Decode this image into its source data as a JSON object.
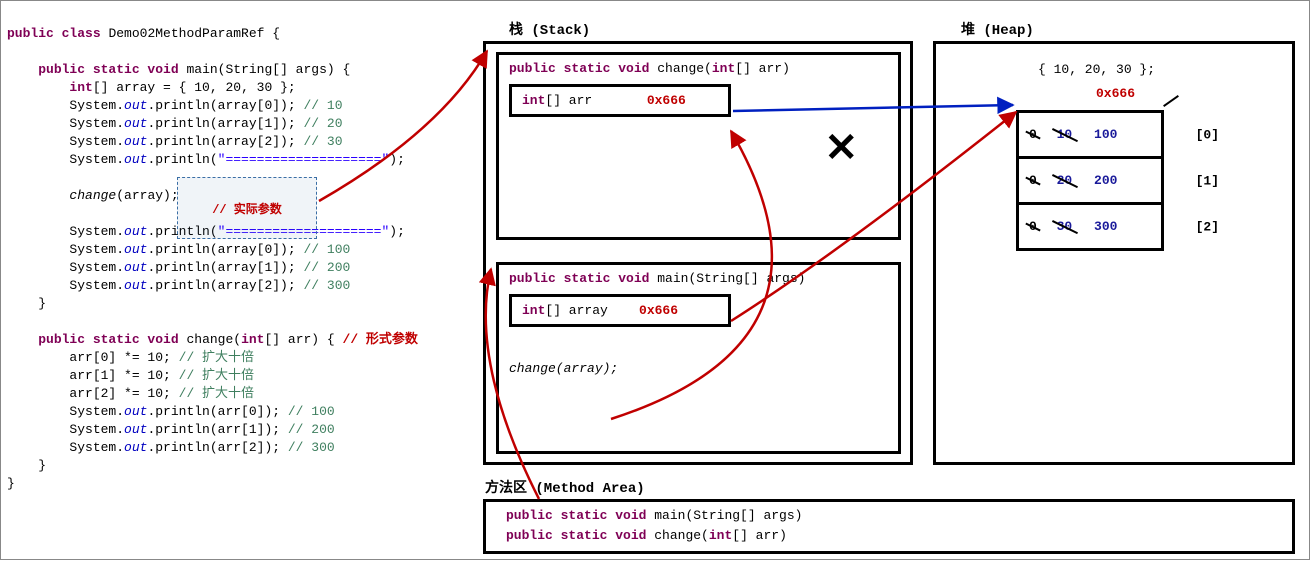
{
  "code": {
    "className": "Demo02MethodParamRef",
    "mainSig": "main(String[] args)",
    "arrayInit": "{ 10, 20, 30 };",
    "println0a": "System.",
    "out": "out",
    "println0b": ".println(array[0]);",
    "c10": "// 10",
    "println1b": ".println(array[1]);",
    "c20": "// 20",
    "println2b": ".println(array[2]);",
    "c30": "// 30",
    "sep": "\"====================\"",
    "changeCall": "change",
    "changeArg": "(array);",
    "actualParam": "// 实际参数",
    "after0b": ".println(array[0]);",
    "ca100": "// 100",
    "after1b": ".println(array[1]);",
    "ca200": "// 200",
    "after2b": ".println(array[2]);",
    "ca300": "// 300",
    "changeSig": "change(",
    "changeParam": "int",
    "changeParamRest": "[] arr) {",
    "formalParam": "// 形式参数",
    "body0": "arr[0] *= 10;",
    "expand": "// 扩大十倍",
    "body1": "arr[1] *= 10;",
    "body2": "arr[2] *= 10;",
    "carr0": ".println(arr[0]);",
    "cc100": "// 100",
    "carr1": ".println(arr[1]);",
    "cc200": "// 200",
    "carr2": ".println(arr[2]);",
    "cc300": "// 300"
  },
  "labels": {
    "stack": "栈 (Stack)",
    "heap": "堆 (Heap)",
    "methodArea": "方法区  (Method Area)"
  },
  "stack": {
    "changeSig": "public static void change(int[] arr)",
    "arrVar": "int[] arr",
    "arrAddr": "0x666",
    "mainSig": "public static void main(String[] args)",
    "arrayVar": "int[] array",
    "arrayAddr": "0x666",
    "call": "change(array);"
  },
  "heap": {
    "init": "{ 10, 20, 30 };",
    "addr": "0x666",
    "cells": [
      {
        "old0": "0",
        "old": "10",
        "new": "100",
        "idx": "[0]"
      },
      {
        "old0": "0",
        "old": "20",
        "new": "200",
        "idx": "[1]"
      },
      {
        "old0": "0",
        "old": "30",
        "new": "300",
        "idx": "[2]"
      }
    ]
  },
  "methodArea": {
    "mainSig": "public static void main(String[] args)",
    "changeSig": "public static void change(int[] arr)"
  }
}
